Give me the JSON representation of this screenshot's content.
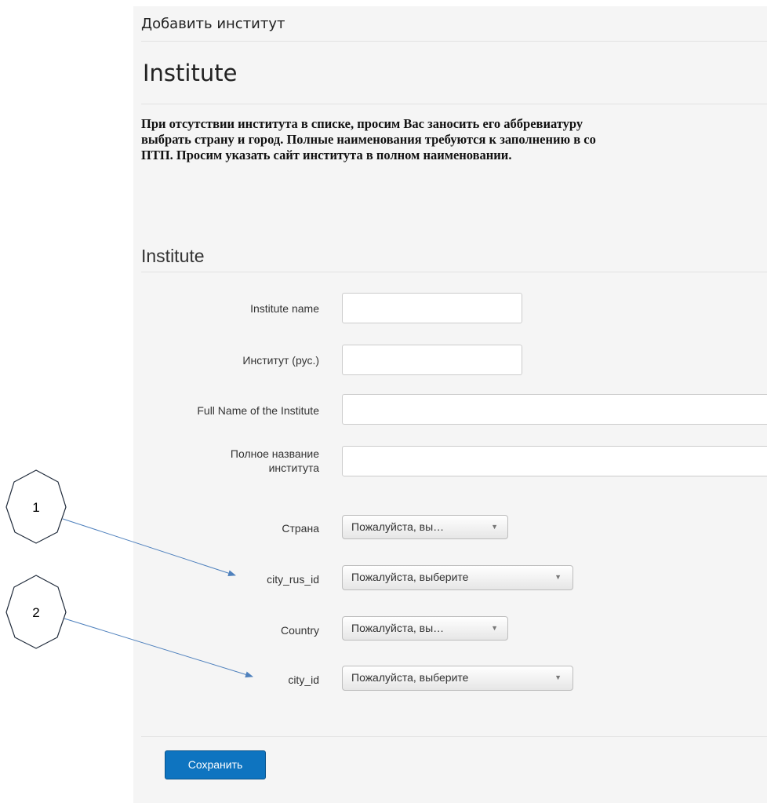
{
  "header": {
    "breadcrumb": "Добавить институт",
    "title": "Institute"
  },
  "notice": {
    "lines": [
      "При отсутствии института в списке, просим Вас заносить его аббревиатуру",
      "выбрать страну и город. Полные наименования требуются к заполнению в со",
      "ПТП. Просим указать сайт института в полном наименовании."
    ]
  },
  "form": {
    "section_title": "Institute",
    "fields": {
      "institute_name": {
        "label": "Institute name",
        "value": ""
      },
      "institute_rus": {
        "label": "Институт (рус.)",
        "value": ""
      },
      "full_name": {
        "label": "Full Name of the Institute",
        "value": ""
      },
      "full_name_rus": {
        "label_line1": "Полное название",
        "label_line2": "института",
        "value": ""
      },
      "country_rus": {
        "label": "Страна",
        "selected": "Пожалуйста, вы…"
      },
      "city_rus_id": {
        "label": "city_rus_id",
        "selected": "Пожалуйста, выберите"
      },
      "country": {
        "label": "Country",
        "selected": "Пожалуйста, вы…"
      },
      "city_id": {
        "label": "city_id",
        "selected": "Пожалуйста, выберите"
      }
    },
    "save_label": "Сохранить"
  },
  "icons": {
    "caret": "▼",
    "callout_shape": "heptagon-callout",
    "arrow": "arrow"
  },
  "annotations": [
    {
      "number": "1",
      "target": "city_rus_id"
    },
    {
      "number": "2",
      "target": "city_id"
    }
  ],
  "colors": {
    "accent": "#0e74c0",
    "panel_bg": "#f5f5f5",
    "annotation_line": "#4f81bd"
  }
}
